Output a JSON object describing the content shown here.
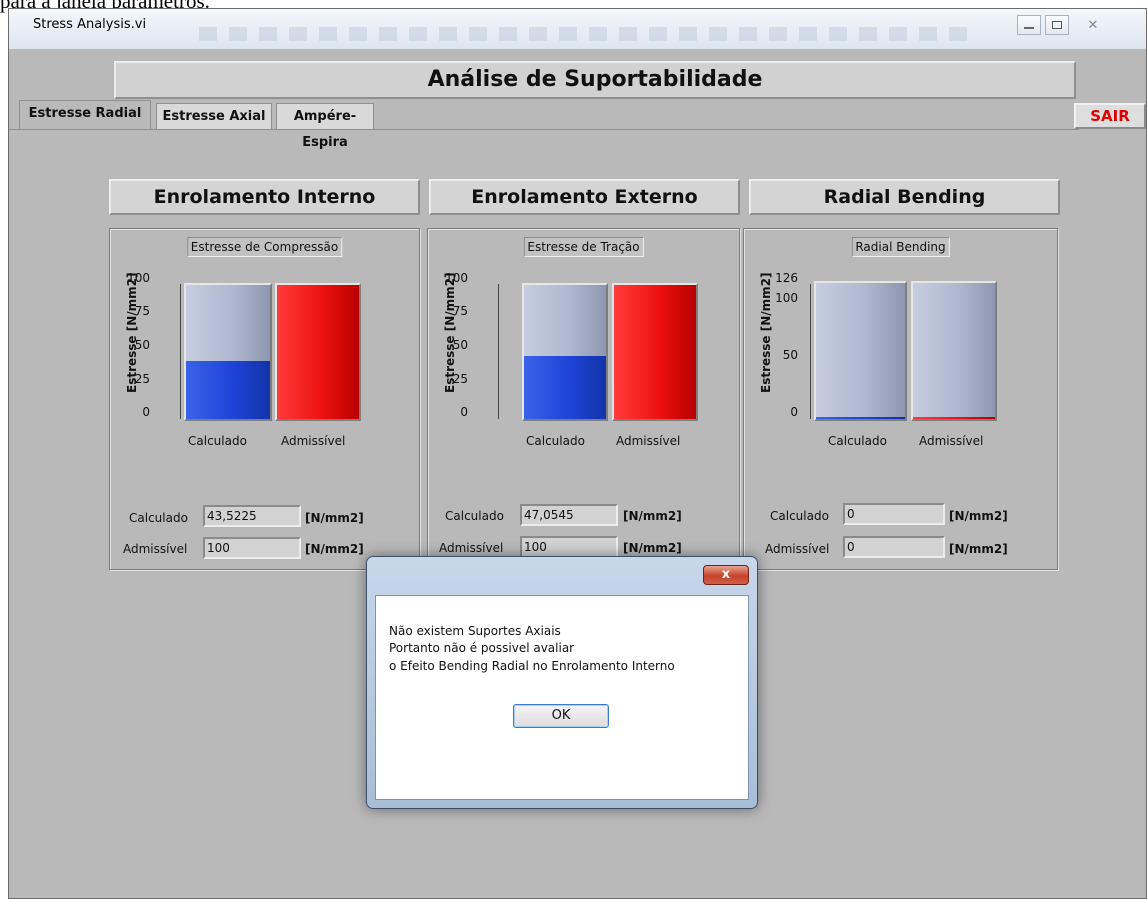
{
  "caption": "para a janela parâmetros.",
  "window": {
    "title": "Stress Analysis.vi",
    "minimize_icon": "minimize-icon",
    "maximize_icon": "maximize-icon",
    "close_icon": "close-icon"
  },
  "banner": "Análise de Suportabilidade",
  "tabs": [
    {
      "label": "Estresse Radial",
      "active": true
    },
    {
      "label": "Estresse Axial",
      "active": false
    },
    {
      "label": "Ampére-Espira",
      "active": false
    }
  ],
  "sair_label": "SAIR",
  "colors": {
    "calculated_fill": "#1d44d8",
    "admissible_fill": "#ee1111",
    "background": "#b9b9b9"
  },
  "sections": [
    {
      "heading": "Enrolamento Interno",
      "chart_title": "Estresse de Compressão",
      "ylabel": "Estresse [N/mm2]",
      "ticks": [
        "100",
        "75",
        "50",
        "25",
        "0"
      ],
      "categories": [
        "Calculado",
        "Admissível"
      ],
      "calculado_label": "Calculado",
      "calculado_value": "43,5225",
      "admissivel_label": "Admissível",
      "admissivel_value": "100",
      "unit": "[N/mm2]"
    },
    {
      "heading": "Enrolamento Externo",
      "chart_title": "Estresse de Tração",
      "ylabel": "Estresse [N/mm2]",
      "ticks": [
        "100",
        "75",
        "50",
        "25",
        "0"
      ],
      "categories": [
        "Calculado",
        "Admissível"
      ],
      "calculado_label": "Calculado",
      "calculado_value": "47,0545",
      "admissivel_label": "Admissível",
      "admissivel_value": "100",
      "unit": "[N/mm2]"
    },
    {
      "heading": "Radial Bending",
      "chart_title": "Radial Bending",
      "ylabel": "Estresse [N/mm2]",
      "ticks": [
        "126",
        "100",
        "50",
        "0"
      ],
      "categories": [
        "Calculado",
        "Admissível"
      ],
      "calculado_label": "Calculado",
      "calculado_value": "0",
      "admissivel_label": "Admissível",
      "admissivel_value": "0",
      "unit": "[N/mm2]"
    }
  ],
  "chart_data": [
    {
      "type": "bar",
      "title": "Estresse de Compressão",
      "ylabel": "Estresse [N/mm2]",
      "ylim": [
        0,
        100
      ],
      "categories": [
        "Calculado",
        "Admissível"
      ],
      "values": [
        43.5225,
        100
      ]
    },
    {
      "type": "bar",
      "title": "Estresse de Tração",
      "ylabel": "Estresse [N/mm2]",
      "ylim": [
        0,
        100
      ],
      "categories": [
        "Calculado",
        "Admissível"
      ],
      "values": [
        47.0545,
        100
      ]
    },
    {
      "type": "bar",
      "title": "Radial Bending",
      "ylabel": "Estresse [N/mm2]",
      "ylim": [
        0,
        126
      ],
      "categories": [
        "Calculado",
        "Admissível"
      ],
      "values": [
        0,
        0
      ]
    }
  ],
  "dialog": {
    "close_label": "x",
    "lines": [
      "Não existem Suportes Axiais",
      "Portanto não é possivel avaliar",
      "o Efeito Bending Radial no Enrolamento Interno"
    ],
    "ok_label": "OK"
  }
}
